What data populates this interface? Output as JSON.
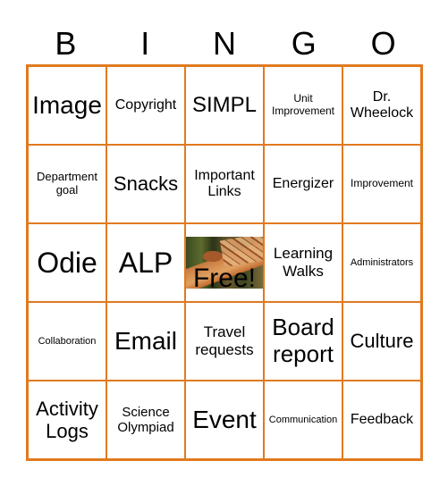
{
  "header": {
    "letters": [
      "B",
      "I",
      "N",
      "G",
      "O"
    ]
  },
  "colors": {
    "border": "#e07a1f"
  },
  "board": {
    "rows": [
      [
        "Image",
        "Copyright",
        "SIMPL",
        "Unit Improvement",
        "Dr. Wheelock"
      ],
      [
        "Department goal",
        "Snacks",
        "Important Links",
        "Energizer",
        "Improvement"
      ],
      [
        "Odie",
        "ALP",
        "Free!",
        "Learning Walks",
        "Administrators"
      ],
      [
        "Collaboration",
        "Email",
        "Travel requests",
        "Board report",
        "Culture"
      ],
      [
        "Activity Logs",
        "Science Olympiad",
        "Event",
        "Communication",
        "Feedback"
      ]
    ],
    "free_image": "giraffe-photo"
  }
}
